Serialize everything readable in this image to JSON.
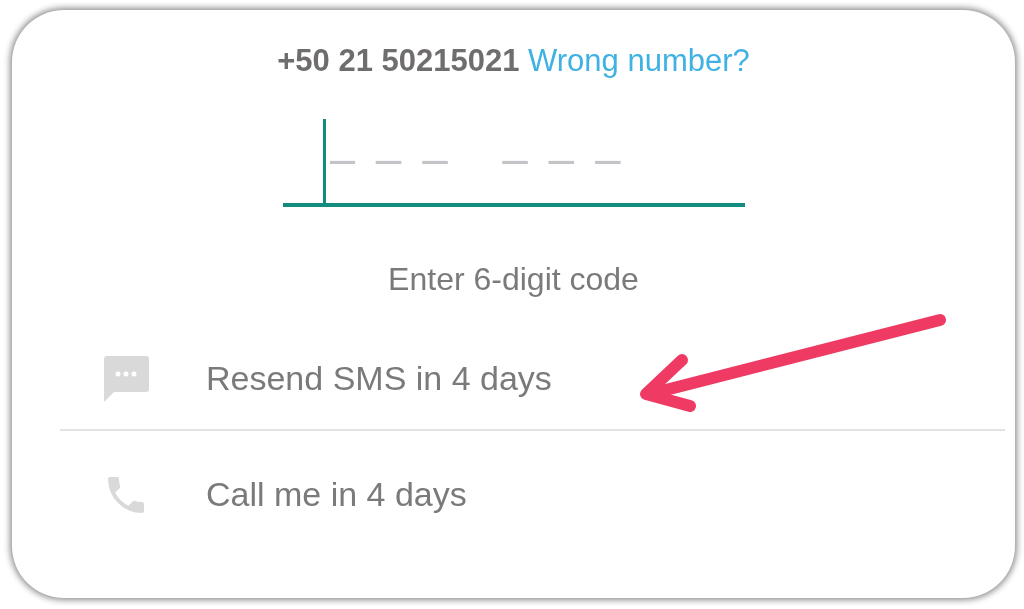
{
  "phone_number": "+50 21 50215021",
  "wrong_number_link": "Wrong number?",
  "code_field": {
    "placeholder": "– – –   – – –",
    "focused": true
  },
  "hint": "Enter 6-digit code",
  "actions": [
    {
      "kind": "sms",
      "label": "Resend SMS in 4 days"
    },
    {
      "kind": "call",
      "label": "Call me in 4 days"
    }
  ]
}
